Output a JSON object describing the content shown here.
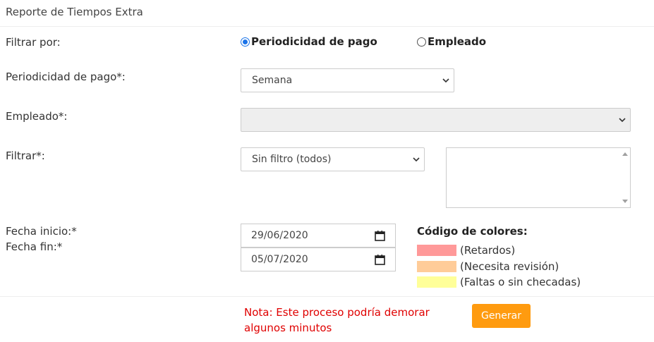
{
  "header": {
    "title": "Reporte de Tiempos Extra"
  },
  "filter_by": {
    "label": "Filtrar por:",
    "options": [
      {
        "label": "Periodicidad de pago",
        "checked": true
      },
      {
        "label": "Empleado",
        "checked": false
      }
    ]
  },
  "pay_period": {
    "label": "Periodicidad de pago*:",
    "value": "Semana"
  },
  "employee": {
    "label": "Empleado*:",
    "value": ""
  },
  "filter": {
    "label": "Filtrar*:",
    "value": "Sin filtro (todos)"
  },
  "dates": {
    "start_label": "Fecha inicio:*",
    "end_label": "Fecha fin:*",
    "start_value": "29/06/2020",
    "end_value": "05/07/2020"
  },
  "legend": {
    "title": "Código de colores:",
    "items": [
      {
        "label": "(Retardos)",
        "color": "#ff9999"
      },
      {
        "label": "(Necesita revisión)",
        "color": "#ffcc99"
      },
      {
        "label": "(Faltas o sin checadas)",
        "color": "#ffff99"
      }
    ]
  },
  "footer": {
    "note": "Nota: Este proceso podría demorar algunos minutos",
    "generate_label": "Generar"
  },
  "colors": {
    "accent": "#ff9b0f",
    "note": "#e00000",
    "radio": "#1a73e8"
  }
}
